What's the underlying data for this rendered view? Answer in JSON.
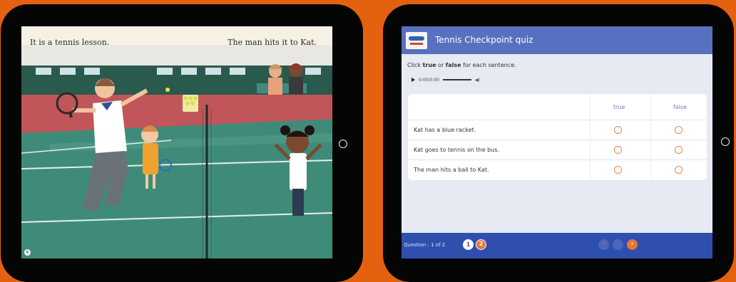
{
  "book": {
    "caption_left": "It is a tennis lesson.",
    "caption_right": "The man hits it to Kat.",
    "page_number": "6"
  },
  "quiz": {
    "title": "Tennis Checkpoint quiz",
    "instruction_prefix": "Click ",
    "instruction_true": "true",
    "instruction_mid": " or ",
    "instruction_false": "false",
    "instruction_suffix": " for each sentence.",
    "audio_time": "0:00/0:00",
    "col_true": "true",
    "col_false": "false",
    "rows": [
      {
        "text": "Kat has a blue racket."
      },
      {
        "text": "Kat goes to tennis on the bus."
      },
      {
        "text": "The man hits a ball to Kat."
      }
    ],
    "footer_question": "Question : 1 of 2",
    "page_dots": [
      "1",
      "2"
    ]
  },
  "colors": {
    "background": "#e4620f",
    "arrow": "#f6c00c",
    "quiz_header": "#5870c0",
    "quiz_footer": "#2f4fae",
    "radio": "#e68a58"
  },
  "icons": [
    "arrow-right-icon",
    "play-icon",
    "volume-icon",
    "prev-icon",
    "next-icon",
    "home-button-icon"
  ]
}
